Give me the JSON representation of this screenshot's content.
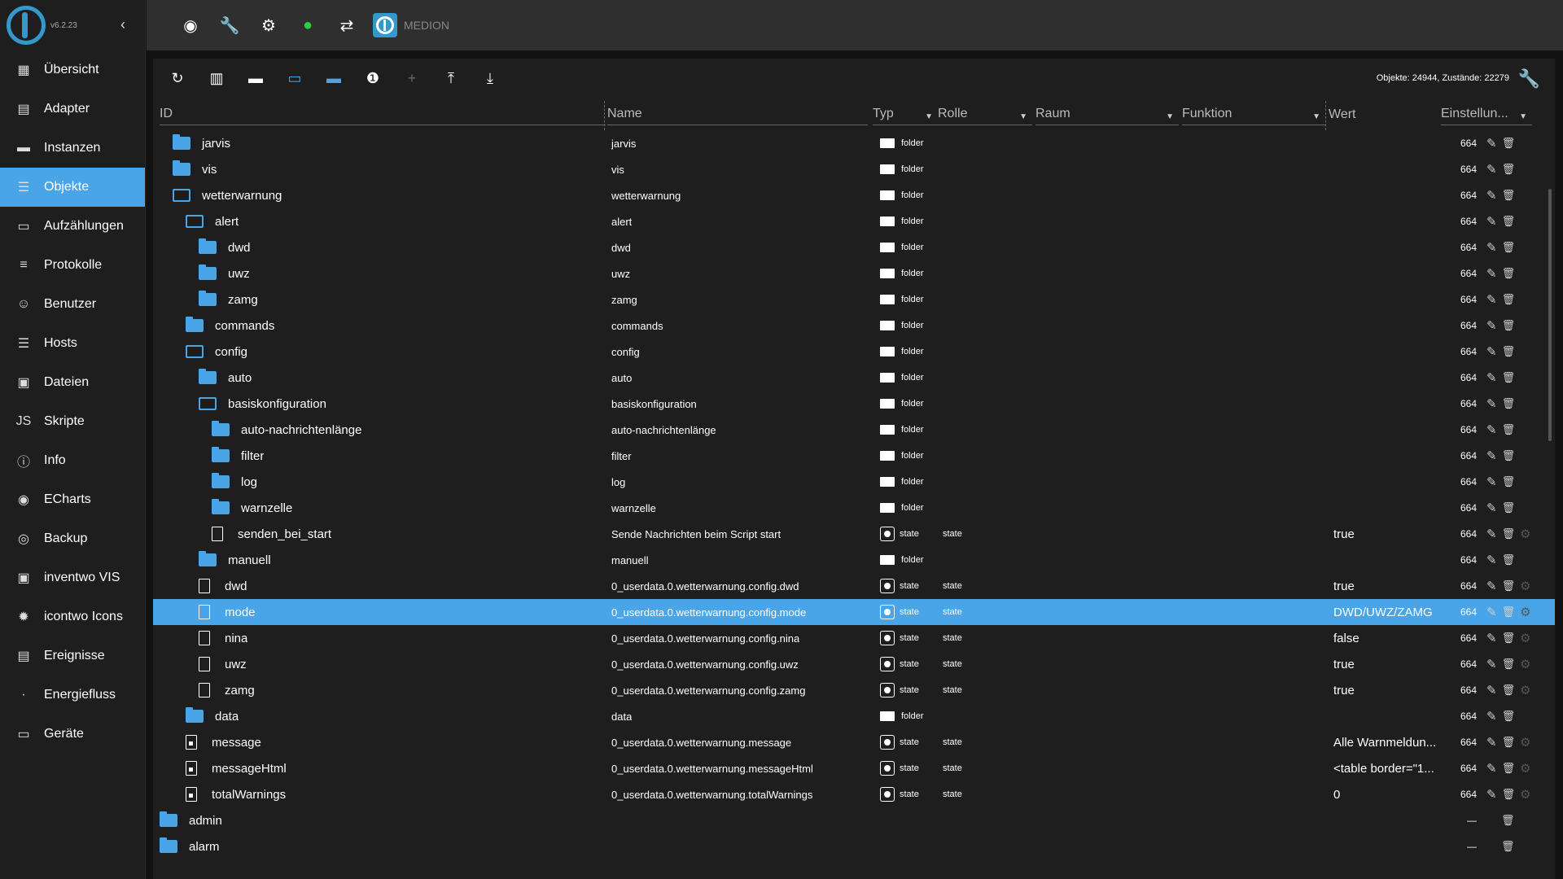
{
  "app": {
    "version": "v6.2.23",
    "hostname": "MEDION"
  },
  "sidebar": {
    "items": [
      {
        "label": "Übersicht",
        "icon": "grid-icon"
      },
      {
        "label": "Adapter",
        "icon": "store-icon"
      },
      {
        "label": "Instanzen",
        "icon": "instances-icon"
      },
      {
        "label": "Objekte",
        "icon": "list-icon",
        "active": true
      },
      {
        "label": "Aufzählungen",
        "icon": "enum-icon"
      },
      {
        "label": "Protokolle",
        "icon": "lines-icon"
      },
      {
        "label": "Benutzer",
        "icon": "user-icon"
      },
      {
        "label": "Hosts",
        "icon": "hosts-icon"
      },
      {
        "label": "Dateien",
        "icon": "files-icon"
      },
      {
        "label": "Skripte",
        "icon": "js-icon"
      },
      {
        "label": "Info",
        "icon": "info-icon"
      },
      {
        "label": "ECharts",
        "icon": "echarts-icon"
      },
      {
        "label": "Backup",
        "icon": "backup-icon"
      },
      {
        "label": "inventwo VIS",
        "icon": "inventwo-icon"
      },
      {
        "label": "icontwo Icons",
        "icon": "icontwo-icon"
      },
      {
        "label": "Ereignisse",
        "icon": "events-icon"
      },
      {
        "label": "Energiefluss",
        "icon": "energy-icon"
      },
      {
        "label": "Geräte",
        "icon": "devices-icon"
      }
    ]
  },
  "objects": {
    "counts": "Objekte: 24944, Zustände: 22279",
    "headers": {
      "id": "ID",
      "name": "Name",
      "type": "Typ",
      "role": "Rolle",
      "room": "Raum",
      "function": "Funktion",
      "value": "Wert",
      "settings": "Einstellun..."
    },
    "rows": [
      {
        "id": "jarvis",
        "indent": 1,
        "icon": "folder",
        "name": "jarvis",
        "type": "folder",
        "role": "",
        "value": "",
        "acl": "664"
      },
      {
        "id": "vis",
        "indent": 1,
        "icon": "folder",
        "name": "vis",
        "type": "folder",
        "role": "",
        "value": "",
        "acl": "664"
      },
      {
        "id": "wetterwarnung",
        "indent": 1,
        "icon": "folder-open",
        "name": "wetterwarnung",
        "type": "folder",
        "role": "",
        "value": "",
        "acl": "664"
      },
      {
        "id": "alert",
        "indent": 2,
        "icon": "folder-open",
        "name": "alert",
        "type": "folder",
        "role": "",
        "value": "",
        "acl": "664"
      },
      {
        "id": "dwd",
        "indent": 3,
        "icon": "folder",
        "name": "dwd",
        "type": "folder",
        "role": "",
        "value": "",
        "acl": "664"
      },
      {
        "id": "uwz",
        "indent": 3,
        "icon": "folder",
        "name": "uwz",
        "type": "folder",
        "role": "",
        "value": "",
        "acl": "664"
      },
      {
        "id": "zamg",
        "indent": 3,
        "icon": "folder",
        "name": "zamg",
        "type": "folder",
        "role": "",
        "value": "",
        "acl": "664"
      },
      {
        "id": "commands",
        "indent": 2,
        "icon": "folder",
        "name": "commands",
        "type": "folder",
        "role": "",
        "value": "",
        "acl": "664"
      },
      {
        "id": "config",
        "indent": 2,
        "icon": "folder-open",
        "name": "config",
        "type": "folder",
        "role": "",
        "value": "",
        "acl": "664"
      },
      {
        "id": "auto",
        "indent": 3,
        "icon": "folder",
        "name": "auto",
        "type": "folder",
        "role": "",
        "value": "",
        "acl": "664"
      },
      {
        "id": "basiskonfiguration",
        "indent": 3,
        "icon": "folder-open",
        "name": "basiskonfiguration",
        "type": "folder",
        "role": "",
        "value": "",
        "acl": "664"
      },
      {
        "id": "auto-nachrichtenlänge",
        "indent": 4,
        "icon": "folder",
        "name": "auto-nachrichtenlänge",
        "type": "folder",
        "role": "",
        "value": "",
        "acl": "664"
      },
      {
        "id": "filter",
        "indent": 4,
        "icon": "folder",
        "name": "filter",
        "type": "folder",
        "role": "",
        "value": "",
        "acl": "664"
      },
      {
        "id": "log",
        "indent": 4,
        "icon": "folder",
        "name": "log",
        "type": "folder",
        "role": "",
        "value": "",
        "acl": "664"
      },
      {
        "id": "warnzelle",
        "indent": 4,
        "icon": "folder",
        "name": "warnzelle",
        "type": "folder",
        "role": "",
        "value": "",
        "acl": "664"
      },
      {
        "id": "senden_bei_start",
        "indent": 4,
        "icon": "doc",
        "name": "Sende Nachrichten beim Script start",
        "type": "state",
        "role": "state",
        "value": "true",
        "acl": "664"
      },
      {
        "id": "manuell",
        "indent": 3,
        "icon": "folder",
        "name": "manuell",
        "type": "folder",
        "role": "",
        "value": "",
        "acl": "664"
      },
      {
        "id": "dwd",
        "indent": 3,
        "icon": "doc",
        "name": "0_userdata.0.wetterwarnung.config.dwd",
        "type": "state",
        "role": "state",
        "value": "true",
        "acl": "664"
      },
      {
        "id": "mode",
        "indent": 3,
        "icon": "doc",
        "name": "0_userdata.0.wetterwarnung.config.mode",
        "type": "state",
        "role": "state",
        "value": "DWD/UWZ/ZAMG",
        "acl": "664",
        "selected": true
      },
      {
        "id": "nina",
        "indent": 3,
        "icon": "doc",
        "name": "0_userdata.0.wetterwarnung.config.nina",
        "type": "state",
        "role": "state",
        "value": "false",
        "acl": "664"
      },
      {
        "id": "uwz",
        "indent": 3,
        "icon": "doc",
        "name": "0_userdata.0.wetterwarnung.config.uwz",
        "type": "state",
        "role": "state",
        "value": "true",
        "acl": "664"
      },
      {
        "id": "zamg",
        "indent": 3,
        "icon": "doc",
        "name": "0_userdata.0.wetterwarnung.config.zamg",
        "type": "state",
        "role": "state",
        "value": "true",
        "acl": "664"
      },
      {
        "id": "data",
        "indent": 2,
        "icon": "folder",
        "name": "data",
        "type": "folder",
        "role": "",
        "value": "",
        "acl": "664"
      },
      {
        "id": "message",
        "indent": 2,
        "icon": "lockdoc",
        "name": "0_userdata.0.wetterwarnung.message",
        "type": "state",
        "role": "state",
        "value": "Alle Warnmeldun...",
        "acl": "664"
      },
      {
        "id": "messageHtml",
        "indent": 2,
        "icon": "lockdoc",
        "name": "0_userdata.0.wetterwarnung.messageHtml",
        "type": "state",
        "role": "state",
        "value": "<table border=\"1...",
        "acl": "664"
      },
      {
        "id": "totalWarnings",
        "indent": 2,
        "icon": "lockdoc",
        "name": "0_userdata.0.wetterwarnung.totalWarnings",
        "type": "state",
        "role": "state",
        "value": "0",
        "acl": "664"
      },
      {
        "id": "admin",
        "indent": 0,
        "icon": "folder",
        "name": "",
        "type": "",
        "role": "",
        "value": "",
        "acl": "—"
      },
      {
        "id": "alarm",
        "indent": 0,
        "icon": "folder",
        "name": "",
        "type": "",
        "role": "",
        "value": "",
        "acl": "—"
      }
    ]
  },
  "colors": {
    "accent": "#4aa5e8",
    "selected_row": "#4aa5e8",
    "sidebar_bg": "#1e1e1e",
    "topbar_bg": "#2f2f2f"
  }
}
